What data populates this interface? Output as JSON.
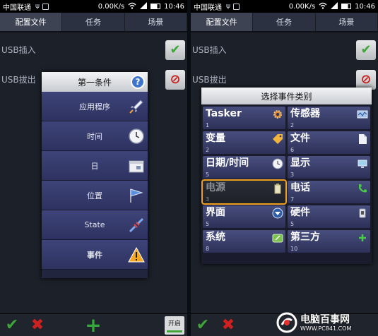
{
  "status_left": {
    "carrier": "中国联通",
    "speed": "0.00K/s",
    "time": "10:46"
  },
  "status_right": {
    "carrier": "中国联通",
    "speed": "0.00K/s",
    "time": "10:46"
  },
  "tabs": [
    "配置文件",
    "任务",
    "场景"
  ],
  "profiles": [
    {
      "label": "USB插入",
      "state": "check-icon"
    },
    {
      "label": "USB拔出",
      "state": "stop-icon"
    }
  ],
  "first_condition_dialog": {
    "title": "第一条件",
    "items": [
      {
        "label": "应用程序",
        "icon": "rocket-icon"
      },
      {
        "label": "时间",
        "icon": "clock-icon"
      },
      {
        "label": "日",
        "icon": "calendar-icon"
      },
      {
        "label": "位置",
        "icon": "flag-icon"
      },
      {
        "label": "State",
        "icon": "plug-icon"
      },
      {
        "label": "事件",
        "icon": "warning-icon"
      }
    ]
  },
  "event_category_dialog": {
    "title": "选择事件类别",
    "categories": [
      {
        "name": "Tasker",
        "num": "1",
        "icon": "gear-icon"
      },
      {
        "name": "传感器",
        "num": "2",
        "icon": "sensor-icon"
      },
      {
        "name": "变量",
        "num": "2",
        "icon": "tag-icon"
      },
      {
        "name": "文件",
        "num": "6",
        "icon": "file-icon"
      },
      {
        "name": "日期/时间",
        "num": "5",
        "icon": "clock-icon"
      },
      {
        "name": "显示",
        "num": "3",
        "icon": "monitor-icon"
      },
      {
        "name": "电源",
        "num": "3",
        "icon": "battery-icon"
      },
      {
        "name": "电话",
        "num": "7",
        "icon": "phone-icon"
      },
      {
        "name": "界面",
        "num": "5",
        "icon": "chevron-down-icon"
      },
      {
        "name": "硬件",
        "num": "5",
        "icon": "device-icon"
      },
      {
        "name": "系统",
        "num": "8",
        "icon": "system-icon"
      },
      {
        "name": "第三方",
        "num": "10",
        "icon": "plus-icon"
      }
    ],
    "selected": "电源"
  },
  "bottombar": {
    "on_label": "开启"
  },
  "watermark": {
    "title": "电脑百事网",
    "url": "WWW.PC841.COM"
  },
  "colors": {
    "accent_select": "#f0a020",
    "check": "#3fa43a",
    "stop": "#c71f1f",
    "help": "#3e74c9"
  }
}
